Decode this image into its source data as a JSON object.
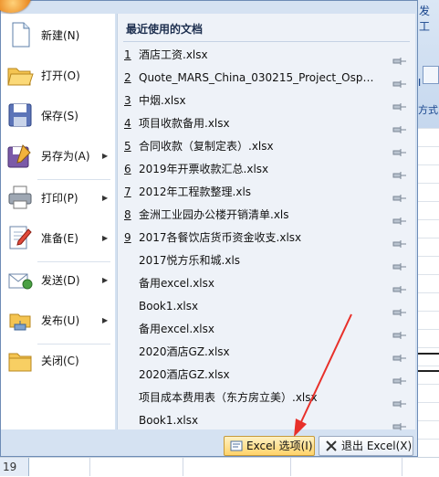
{
  "ribbon": {
    "title_fragment": "发工",
    "label_fragment": "I",
    "group_fragment": "方式"
  },
  "sheet": {
    "row_number": "19"
  },
  "commands": [
    {
      "label": "新建(N)",
      "icon": "new-document-icon",
      "has_arrow": false
    },
    {
      "label": "打开(O)",
      "icon": "open-folder-icon",
      "has_arrow": false
    },
    {
      "label": "保存(S)",
      "icon": "save-disk-icon",
      "has_arrow": false
    },
    {
      "label": "另存为(A)",
      "icon": "save-as-icon",
      "has_arrow": true
    },
    {
      "label": "打印(P)",
      "icon": "printer-icon",
      "has_arrow": true
    },
    {
      "label": "准备(E)",
      "icon": "prepare-pen-icon",
      "has_arrow": true
    },
    {
      "label": "发送(D)",
      "icon": "send-mail-icon",
      "has_arrow": true
    },
    {
      "label": "发布(U)",
      "icon": "publish-server-icon",
      "has_arrow": true
    },
    {
      "label": "关闭(C)",
      "icon": "close-folder-icon",
      "has_arrow": false
    }
  ],
  "recent": {
    "title": "最近使用的文档",
    "files": [
      {
        "num": "1",
        "name": "酒店工资.xlsx"
      },
      {
        "num": "2",
        "name": "Quote_MARS_China_030215_Project_Osprey_..."
      },
      {
        "num": "3",
        "name": "中烟.xlsx"
      },
      {
        "num": "4",
        "name": "项目收款备用.xlsx"
      },
      {
        "num": "5",
        "name": "合同收款（复制定表）.xlsx"
      },
      {
        "num": "6",
        "name": "2019年开票收款汇总.xlsx"
      },
      {
        "num": "7",
        "name": "2012年工程款整理.xls"
      },
      {
        "num": "8",
        "name": "金洲工业园办公楼开销清单.xls"
      },
      {
        "num": "9",
        "name": "2017各餐饮店货币资金收支.xlsx"
      },
      {
        "num": "",
        "name": "2017悦方乐和城.xls"
      },
      {
        "num": "",
        "name": "备用excel.xlsx"
      },
      {
        "num": "",
        "name": "Book1.xlsx"
      },
      {
        "num": "",
        "name": "备用excel.xlsx"
      },
      {
        "num": "",
        "name": "2020酒店GZ.xlsx"
      },
      {
        "num": "",
        "name": "2020酒店GZ.xlsx"
      },
      {
        "num": "",
        "name": "项目成本费用表（东方房立美）.xlsx"
      },
      {
        "num": "",
        "name": "Book1.xlsx"
      }
    ]
  },
  "buttons": {
    "options": "Excel 选项(I)",
    "exit": "退出 Excel(X)"
  },
  "colors": {
    "menu_bg": "#d5e2f2",
    "recent_bg": "#eef2f8",
    "options_button": "#ffd36a",
    "annotation_arrow": "#e8302a"
  }
}
